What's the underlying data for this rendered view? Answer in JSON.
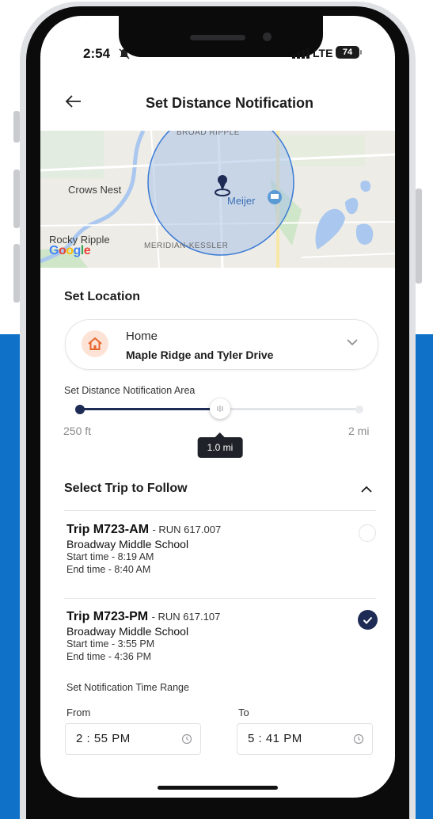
{
  "status": {
    "time": "2:54",
    "network": "LTE",
    "battery": "74"
  },
  "header": {
    "title": "Set Distance Notification"
  },
  "map": {
    "labels": {
      "crows_nest": "Crows Nest",
      "meijer": "Meijer",
      "rocky_ripple": "Rocky Ripple",
      "meridian": "MERIDIAN-KESSLER",
      "top_road": "BROAD RIPPLE"
    },
    "logo": [
      "G",
      "o",
      "o",
      "g",
      "l",
      "e"
    ]
  },
  "location": {
    "section_title": "Set Location",
    "label": "Home",
    "value": "Maple Ridge and Tyler Drive"
  },
  "distance": {
    "label": "Set Distance Notification Area",
    "min": "250 ft",
    "max": "2 mi",
    "value_label": "1.0 mi",
    "fraction": 0.5
  },
  "trips": {
    "section_title": "Select Trip to Follow",
    "items": [
      {
        "title": "Trip M723-AM",
        "run": "- RUN 617.007",
        "school": "Broadway Middle School",
        "start": "Start time - 8:19 AM",
        "end": "End time - 8:40 AM",
        "selected": false
      },
      {
        "title": "Trip M723-PM",
        "run": "- RUN 617.107",
        "school": "Broadway Middle School",
        "start": "Start time - 3:55 PM",
        "end": "End time - 4:36 PM",
        "selected": true
      }
    ]
  },
  "time_range": {
    "label": "Set Notification Time Range",
    "from_label": "From",
    "to_label": "To",
    "from_value": "2 : 55 PM",
    "to_value": "5 : 41 PM"
  },
  "colors": {
    "navy": "#1e2b55",
    "accent_bg": "#0f72c8",
    "home_orange": "#e5652e",
    "map_circle": "#a9c3e8"
  }
}
